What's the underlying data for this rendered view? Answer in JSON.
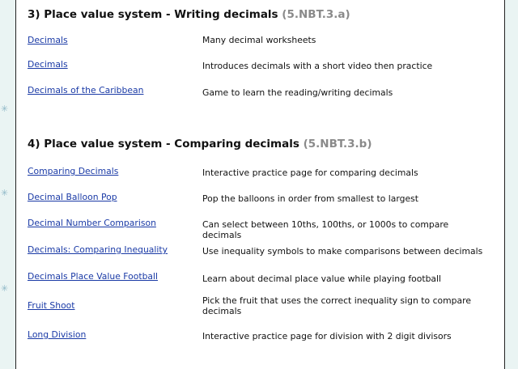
{
  "sections": [
    {
      "title": "3) Place value system - Writing decimals",
      "code": "(5.NBT.3.a)",
      "rows": [
        {
          "link": "Decimals",
          "desc": "Many decimal worksheets"
        },
        {
          "link": "Decimals",
          "desc": "Introduces decimals with a short video then practice"
        },
        {
          "link": "Decimals of the Caribbean",
          "desc": "Game to learn the reading/writing decimals"
        }
      ]
    },
    {
      "title": "4) Place value system - Comparing decimals",
      "code": "(5.NBT.3.b)",
      "rows": [
        {
          "link": "Comparing Decimals",
          "desc": "Interactive practice page for comparing decimals"
        },
        {
          "link": "Decimal Balloon Pop",
          "desc": "Pop the balloons in order from smallest to largest"
        },
        {
          "link": "Decimal Number Comparison",
          "desc": "Can select between 10ths, 100ths, or 1000s to compare decimals"
        },
        {
          "link": "Decimals: Comparing Inequality",
          "desc": "Use inequality symbols to make comparisons between decimals"
        },
        {
          "link": "Decimals Place Value Football",
          "desc": "Learn about decimal place value while playing football"
        },
        {
          "link": "Fruit Shoot",
          "desc": "Pick the fruit that uses the correct inequality sign to compare decimals"
        },
        {
          "link": "Long Division",
          "desc": "Interactive practice page for division with 2 digit divisors"
        }
      ]
    }
  ],
  "colors": {
    "link": "#1a3aa6",
    "code": "#8a8a8a",
    "background_strip": "#eaf4f3"
  },
  "icons": {
    "decoration": "snowflake-icon"
  }
}
